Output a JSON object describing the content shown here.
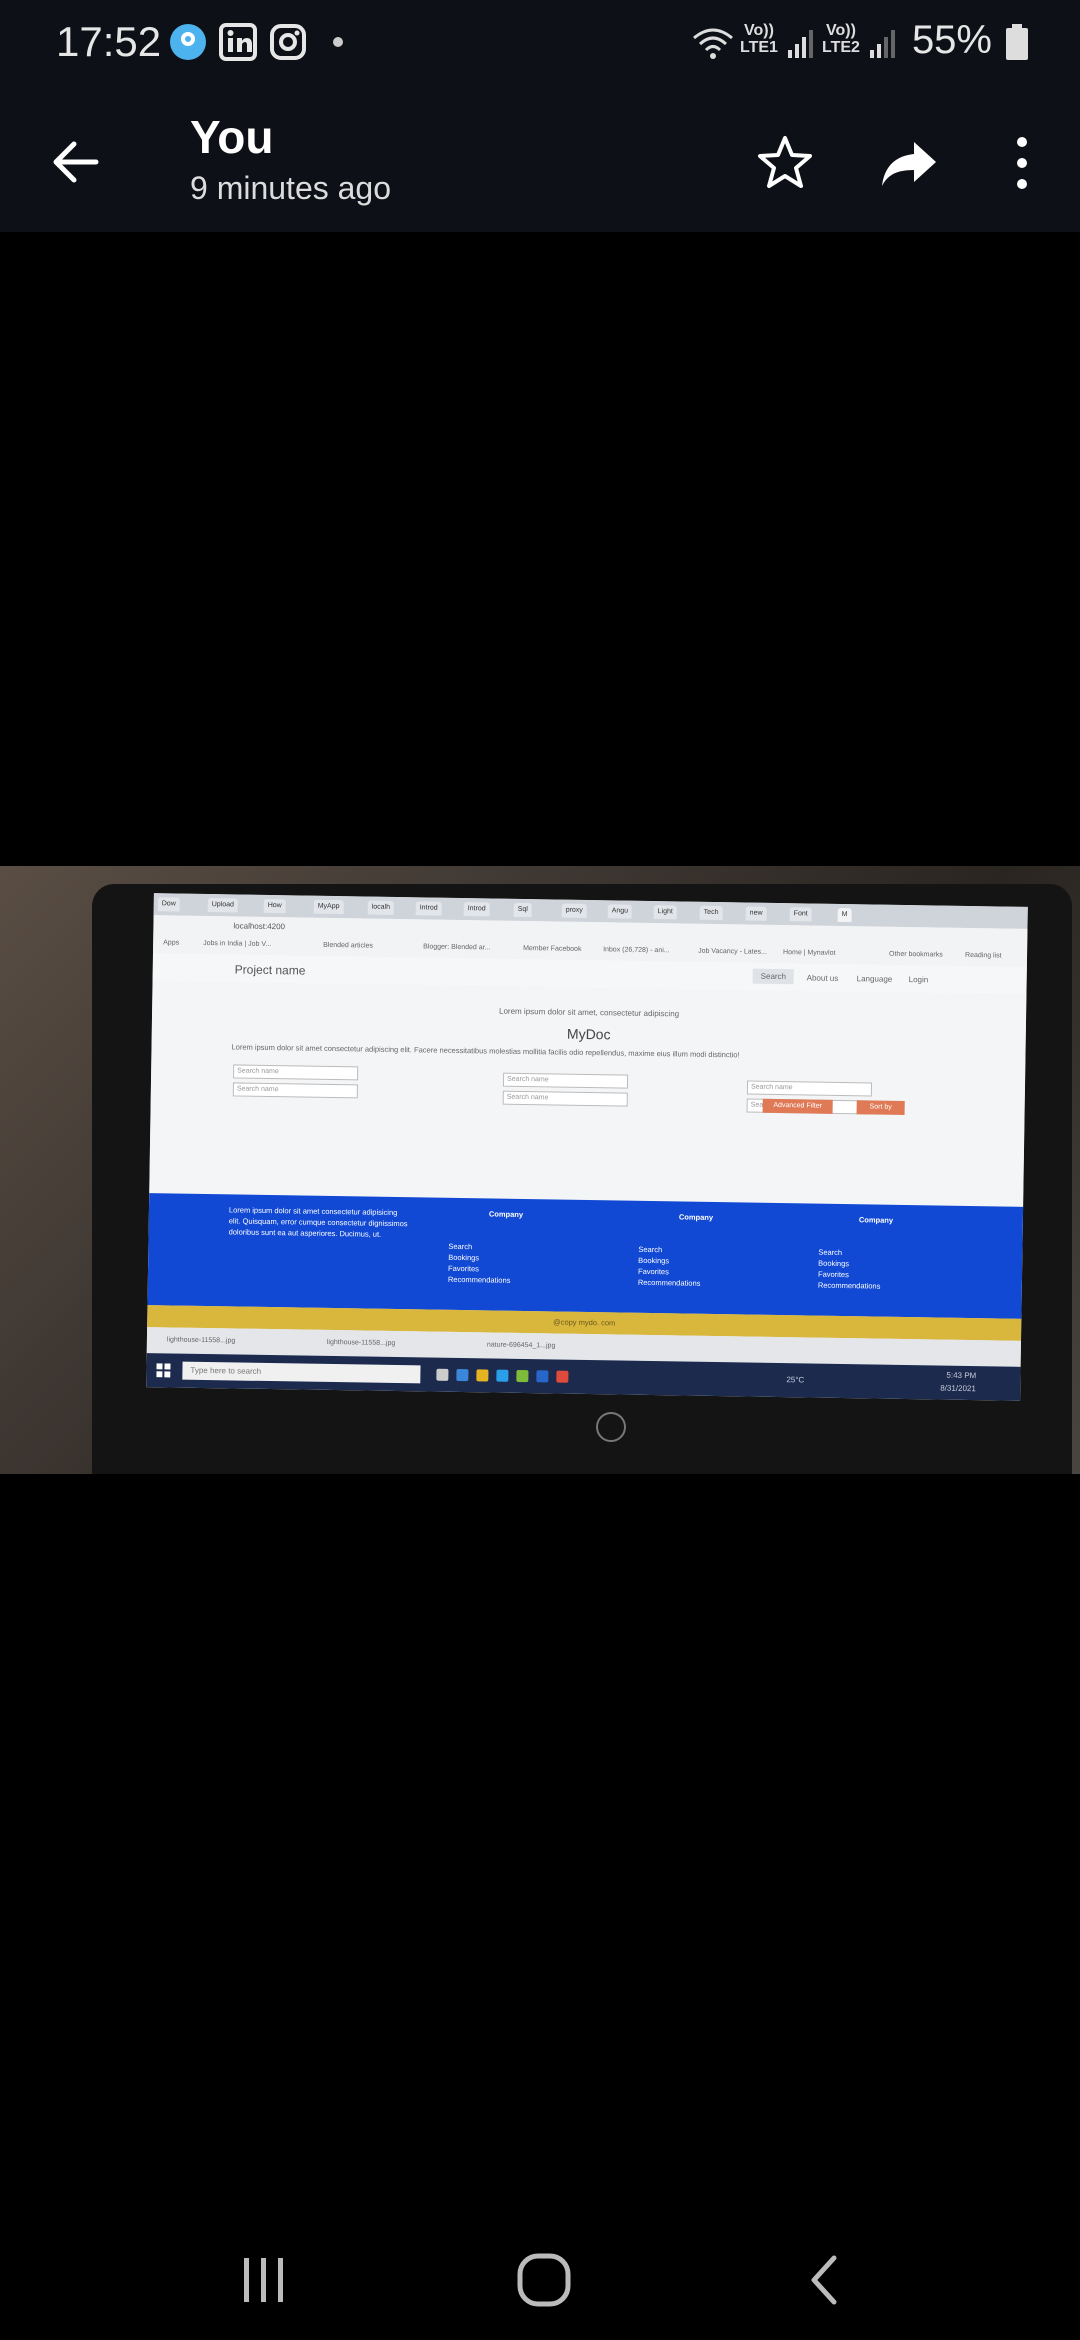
{
  "status": {
    "time": "17:52",
    "network1_top": "Vo))",
    "network1_bottom": "LTE1",
    "network2_top": "Vo))",
    "network2_bottom": "LTE2",
    "battery": "55%"
  },
  "header": {
    "title": "You",
    "subtitle": "9 minutes ago"
  },
  "photo": {
    "browser_tabs": [
      "Dow",
      "Upload",
      "How",
      "MyApp",
      "localh",
      "Introd",
      "Introd",
      "Sql",
      "proxy",
      "Angu",
      "Light",
      "Tech",
      "new",
      "Font",
      "M"
    ],
    "url": "localhost:4200",
    "bookmarks": [
      "Apps",
      "Jobs in India | Job V...",
      "Blended articles",
      "Blogger: Blended ar...",
      "Member Facebook",
      "Inbox (26,728) - ani...",
      "Job Vacancy - Lates...",
      "Home | Mynavlot",
      "Other bookmarks",
      "Reading list"
    ],
    "brand": "Project name",
    "nav": [
      "Search",
      "About us",
      "Language",
      "Login"
    ],
    "lead": "Lorem ipsum dolor sit amet, consectetur adipiscing",
    "heading": "MyDoc",
    "paragraph": "Lorem ipsum dolor sit amet consectetur adipiscing elit. Facere necessitatibus molestias mollitia facilis odio repellendus, maxime eius illum modi distinctio!",
    "search_placeholder": "Search name",
    "advanced_filter": "Advanced Filter",
    "sort_by": "Sort by",
    "footer_text": "Lorem ipsum dolor sit amet consectetur adipisicing elit. Quisquam, error cumque consectetur dignissimos doloribus sunt ea aut asperiores. Ducimus, ut.",
    "footer_columns": [
      {
        "heading": "Company",
        "items": [
          "Search",
          "Bookings",
          "Favorites",
          "Recommendations"
        ]
      },
      {
        "heading": "Company",
        "items": [
          "Search",
          "Bookings",
          "Favorites",
          "Recommendations"
        ]
      },
      {
        "heading": "Company",
        "items": [
          "Search",
          "Bookings",
          "Favorites",
          "Recommendations"
        ]
      }
    ],
    "copyright": "@copy mydo. com",
    "downloads": [
      "lighthouse-11558...jpg",
      "lighthouse-11558...jpg",
      "nature-696454_1...jpg"
    ],
    "taskbar_search": "Type here to search",
    "taskbar_temp": "25°C",
    "taskbar_time": "5:43 PM",
    "taskbar_date": "8/31/2021"
  }
}
